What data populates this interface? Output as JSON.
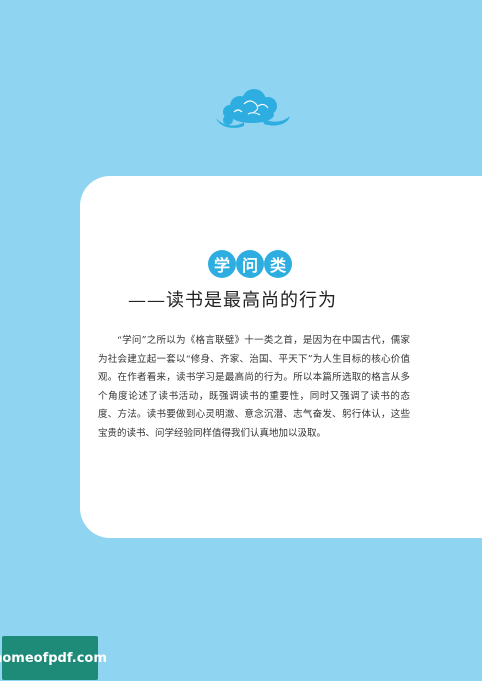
{
  "category": {
    "chars": [
      "学",
      "问",
      "类"
    ]
  },
  "section_title": "——读书是最高尚的行为",
  "intro_paragraph": "“学问”之所以为《格言联璧》十一类之首，是因为在中国古代，儒家为社会建立起一套以“修身、齐家、治国、平天下”为人生目标的核心价值观。在作者看来，读书学习是最高尚的行为。所以本篇所选取的格言从多个角度论述了读书活动，既强调读书的重要性，同时又强调了读书的态度、方法。读书要做到心灵明澈、意念沉潜、志气奋发、躬行体认，这些宝贵的读书、问学经验同样值得我们认真地加以汲取。",
  "watermark": "homeofpdf.com",
  "colors": {
    "page_bg": "#8fd4f0",
    "accent": "#2eaee0",
    "watermark_bg": "#1e8a78"
  }
}
